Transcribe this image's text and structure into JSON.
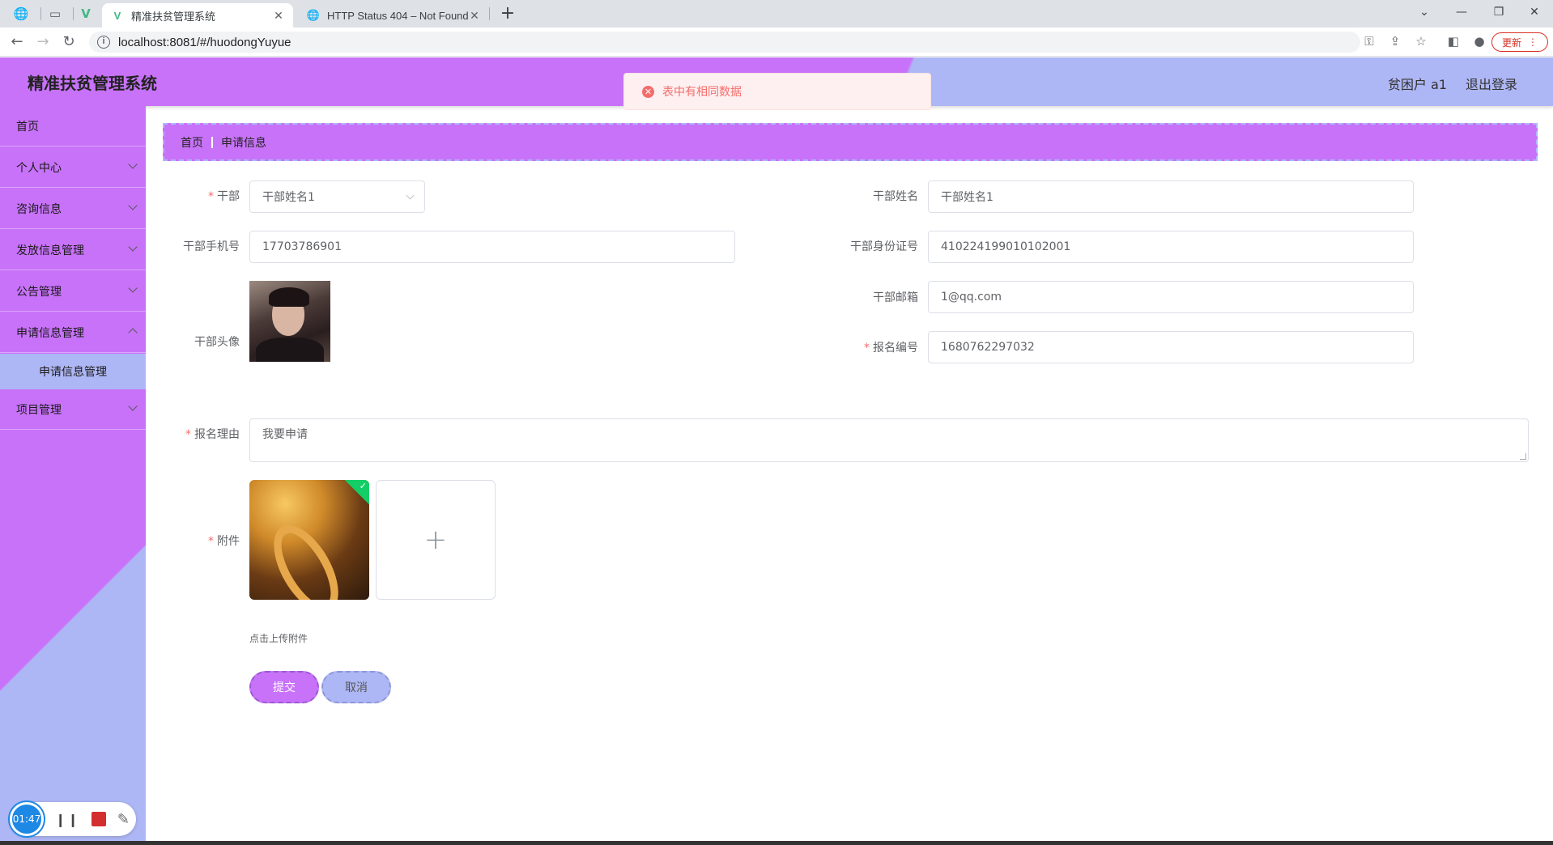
{
  "browser": {
    "tabs": [
      {
        "title": "精准扶贫管理系统",
        "active": true
      },
      {
        "title": "HTTP Status 404 – Not Found",
        "active": false
      }
    ],
    "url": "localhost:8081/#/huodongYuyue",
    "update_label": "更新"
  },
  "header": {
    "app_title": "精准扶贫管理系统",
    "user": "贫困户 a1",
    "logout": "退出登录"
  },
  "toast": {
    "message": "表中有相同数据",
    "type": "error"
  },
  "sidebar": {
    "items": [
      {
        "label": "首页"
      },
      {
        "label": "个人中心"
      },
      {
        "label": "咨询信息"
      },
      {
        "label": "发放信息管理"
      },
      {
        "label": "公告管理"
      },
      {
        "label": "申请信息管理"
      },
      {
        "label": "申请信息管理"
      },
      {
        "label": "项目管理"
      }
    ]
  },
  "breadcrumb": {
    "home": "首页",
    "current": "申请信息"
  },
  "form": {
    "cadre_label": "干部",
    "cadre_value": "干部姓名1",
    "cadre_name_label": "干部姓名",
    "cadre_name_value": "干部姓名1",
    "phone_label": "干部手机号",
    "phone_value": "17703786901",
    "id_label": "干部身份证号",
    "id_value": "410224199010102001",
    "avatar_label": "干部头像",
    "email_label": "干部邮箱",
    "email_value": "1@qq.com",
    "reg_no_label": "报名编号",
    "reg_no_value": "1680762297032",
    "reason_label": "报名理由",
    "reason_value": "我要申请",
    "attachment_label": "附件",
    "upload_tip": "点击上传附件",
    "submit": "提交",
    "cancel": "取消"
  },
  "recorder": {
    "time": "01:47"
  },
  "colors": {
    "primary": "#c872f9",
    "secondary": "#aeb7f5",
    "error": "#f56c6c"
  }
}
